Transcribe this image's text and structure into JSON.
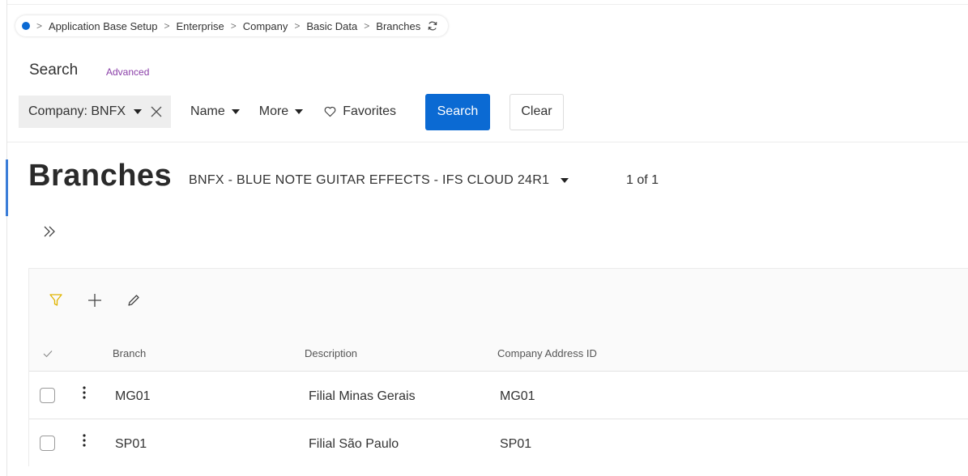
{
  "breadcrumb": {
    "items": [
      "Application Base Setup",
      "Enterprise",
      "Company",
      "Basic Data",
      "Branches"
    ]
  },
  "search": {
    "label": "Search",
    "advanced": "Advanced",
    "company_chip": "Company: BNFX",
    "name_filter": "Name",
    "more_filter": "More",
    "favorites": "Favorites",
    "search_button": "Search",
    "clear_button": "Clear"
  },
  "page": {
    "title": "Branches",
    "record_selector": "BNFX - BLUE NOTE GUITAR EFFECTS - IFS CLOUD 24R1",
    "record_count": "1 of 1"
  },
  "table": {
    "columns": [
      "Branch",
      "Description",
      "Company Address ID"
    ],
    "rows": [
      {
        "branch": "MG01",
        "description": "Filial Minas Gerais",
        "address_id": "MG01"
      },
      {
        "branch": "SP01",
        "description": "Filial São Paulo",
        "address_id": "SP01"
      }
    ]
  },
  "colors": {
    "accent": "#0b6ad3",
    "advanced_link": "#8a3ea8",
    "filter_icon": "#e0b400"
  },
  "icons": {
    "home": "home-dot-icon",
    "refresh": "refresh-icon",
    "clear_chip": "close-icon",
    "favorites": "heart-icon",
    "expand": "double-chevron-right-icon",
    "filter": "filter-icon",
    "add": "plus-icon",
    "edit": "pencil-icon",
    "row_menu": "kebab-menu-icon",
    "select_all": "checkmark-icon"
  }
}
